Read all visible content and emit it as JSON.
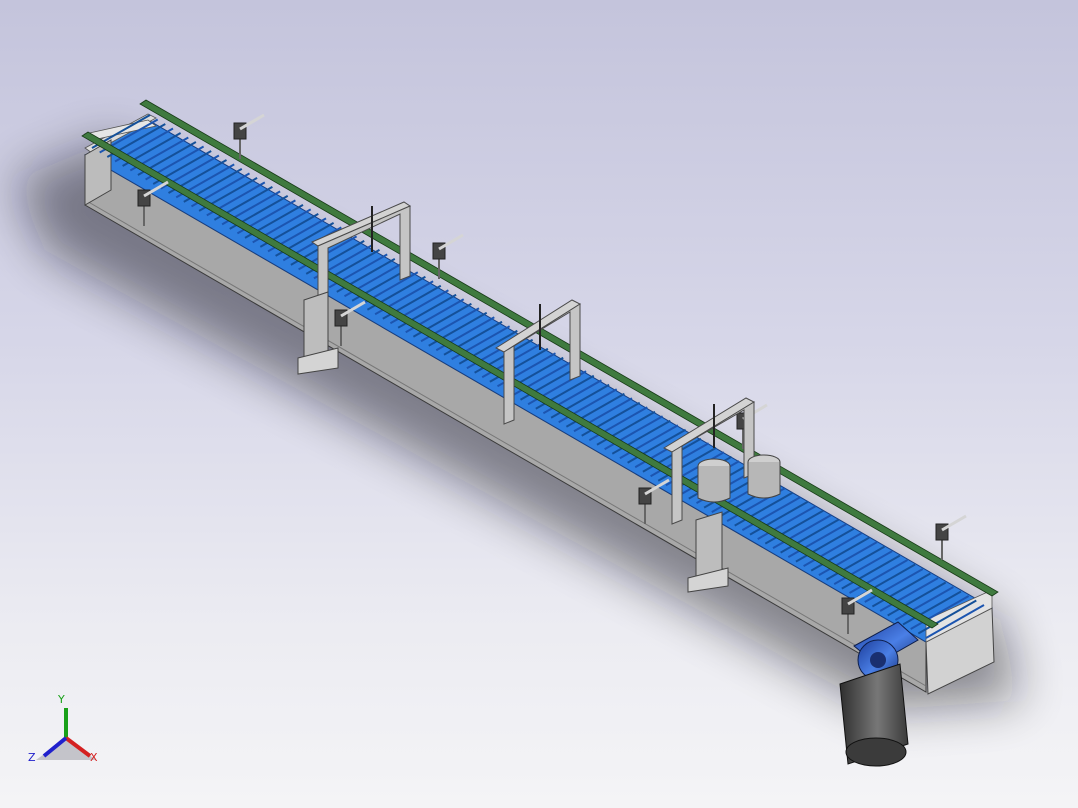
{
  "viewport": {
    "background_top": "#c4c4dc",
    "background_bottom": "#f4f4f6"
  },
  "colors": {
    "belt": "#2f7fe0",
    "belt_dark": "#1a4fa0",
    "guide_rail": "#3f7a3f",
    "frame": "#a8a8a8",
    "motor": "#5a5a5a",
    "gearbox": "#2f58c8"
  },
  "triad": {
    "y_label": "Y",
    "x_label": "X",
    "z_label": "Z",
    "icons": [
      "triad-axis-icon"
    ]
  }
}
